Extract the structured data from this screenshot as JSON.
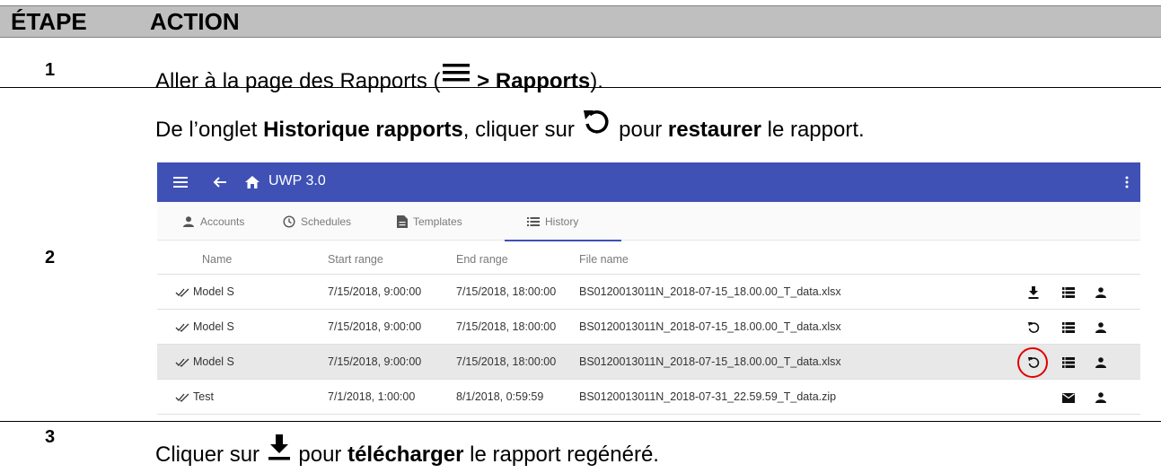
{
  "table_header": {
    "step": "ÉTAPE",
    "action": "ACTION"
  },
  "steps": [
    {
      "number": "1",
      "text_before": "Aller à la page des Rapports (",
      "bold": " > Rapports",
      "text_after": ")."
    },
    {
      "number": "2",
      "text_before": "De l’onglet ",
      "bold1": "Historique rapports",
      "text_mid": ", cliquer sur ",
      "text_mid2": " pour ",
      "bold2": "restaurer",
      "text_after": " le rapport."
    },
    {
      "number": "3",
      "text_before": "Cliquer sur ",
      "text_mid": " pour ",
      "bold": "télécharger",
      "text_after": " le rapport regénéré."
    }
  ],
  "app": {
    "title": "UWP 3.0",
    "tabs": [
      "Accounts",
      "Schedules",
      "Templates",
      "History"
    ],
    "active_tab": "History",
    "columns": [
      "Name",
      "Start range",
      "End range",
      "File name"
    ],
    "rows": [
      {
        "name": "Model S",
        "start": "7/15/2018, 9:00:00",
        "end": "7/15/2018, 18:00:00",
        "file": "BS0120013011N_2018-07-15_18.00.00_T_data.xlsx",
        "action_icon": "download-icon"
      },
      {
        "name": "Model S",
        "start": "7/15/2018, 9:00:00",
        "end": "7/15/2018, 18:00:00",
        "file": "BS0120013011N_2018-07-15_18.00.00_T_data.xlsx",
        "action_icon": "restore-icon"
      },
      {
        "name": "Model S",
        "start": "7/15/2018, 9:00:00",
        "end": "7/15/2018, 18:00:00",
        "file": "BS0120013011N_2018-07-15_18.00.00_T_data.xlsx",
        "action_icon": "restore-icon"
      },
      {
        "name": "Test",
        "start": "7/1/2018, 1:00:00",
        "end": "8/1/2018, 0:59:59",
        "file": "BS0120013011N_2018-07-31_22.59.59_T_data.zip",
        "action_icon": "mail-icon"
      }
    ],
    "colors": {
      "appbar": "#3f51b5",
      "highlight": "#e00000"
    }
  }
}
